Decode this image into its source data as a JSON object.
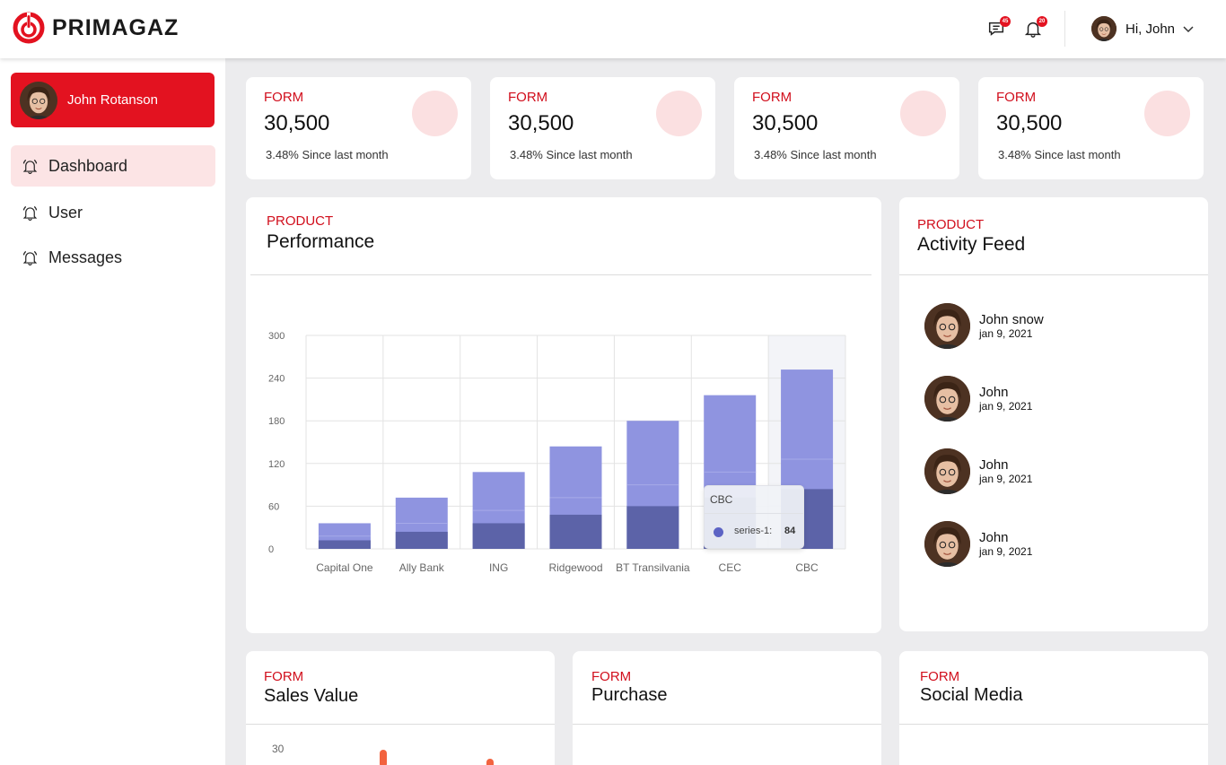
{
  "header": {
    "brand": "PRIMAGAZ",
    "messages_badge": "45",
    "notifications_badge": "20",
    "greeting": "Hi, John"
  },
  "sidebar": {
    "profile_name": "John Rotanson",
    "items": [
      {
        "label": "Dashboard",
        "icon": "bell-icon",
        "active": true
      },
      {
        "label": "User",
        "icon": "bell-icon",
        "active": false
      },
      {
        "label": "Messages",
        "icon": "bell-icon",
        "active": false
      }
    ]
  },
  "stats": [
    {
      "kicker": "FORM",
      "value": "30,500",
      "sub": "3.48% Since last month"
    },
    {
      "kicker": "FORM",
      "value": "30,500",
      "sub": "3.48% Since last month"
    },
    {
      "kicker": "FORM",
      "value": "30,500",
      "sub": "3.48% Since last month"
    },
    {
      "kicker": "FORM",
      "value": "30,500",
      "sub": "3.48% Since last month"
    }
  ],
  "performance": {
    "kicker": "PRODUCT",
    "title": "Performance",
    "tooltip": {
      "title": "CBC",
      "series": "series-1:",
      "value": "84"
    }
  },
  "activity": {
    "kicker": "PRODUCT",
    "title": "Activity Feed",
    "items": [
      {
        "name": "John snow",
        "date": "jan 9, 2021"
      },
      {
        "name": "John",
        "date": "jan 9, 2021"
      },
      {
        "name": "John",
        "date": "jan 9, 2021"
      },
      {
        "name": "John",
        "date": "jan 9, 2021"
      }
    ]
  },
  "bottom_cards": [
    {
      "kicker": "FORM",
      "title": "Sales Value",
      "axis_top": "30"
    },
    {
      "kicker": "FORM",
      "title": "Purchase"
    },
    {
      "kicker": "FORM",
      "title": "Social Media"
    }
  ],
  "colors": {
    "brand_red": "#e31220",
    "bar_light": "#8f94e0",
    "bar_dark": "#5c63a8"
  },
  "chart_data": {
    "type": "bar",
    "categories": [
      "Capital One",
      "Ally Bank",
      "ING",
      "Ridgewood",
      "BT Transilvania",
      "CEC",
      "CBC"
    ],
    "series": [
      {
        "name": "series-1",
        "values": [
          12,
          24,
          36,
          48,
          60,
          72,
          84
        ]
      },
      {
        "values": [
          36,
          72,
          108,
          144,
          180,
          216,
          252
        ]
      }
    ],
    "yticks": [
      0,
      60,
      120,
      180,
      240,
      300
    ],
    "ylim": [
      0,
      300
    ],
    "grid": true,
    "highlighted_category": "CBC"
  }
}
